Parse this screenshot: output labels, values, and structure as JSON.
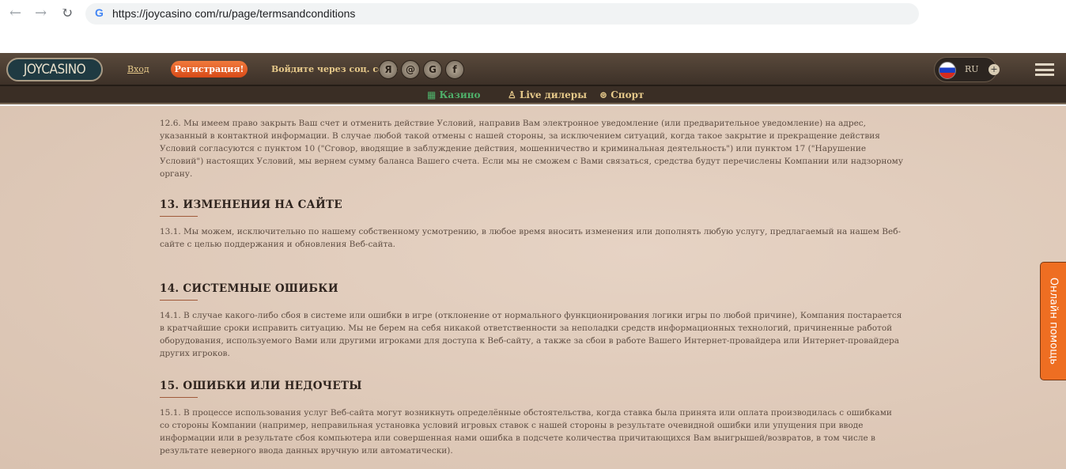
{
  "browser": {
    "url": "https://joycasino com/ru/page/termsandconditions"
  },
  "header": {
    "logo": "JOYCASINO",
    "login": "Вход",
    "register": "Регистрация!",
    "social_label": "Войдите через соц. сети:",
    "social": [
      "Я",
      "@",
      "G",
      "f"
    ],
    "language": "RU"
  },
  "subnav": [
    {
      "icon": "slot-icon",
      "label": "Казино"
    },
    {
      "icon": "dealer-icon",
      "label": "Live дилеры"
    },
    {
      "icon": "ball-icon",
      "label": "Спорт"
    }
  ],
  "content": {
    "p12_6": "12.6. Мы имеем право закрыть Ваш счет и отменить действие Условий, направив Вам электронное уведомление (или предварительное уведомление) на адрес, указанный в контактной информации. В случае любой такой отмены с нашей стороны, за исключением ситуаций, когда такое закрытие и прекращение действия Условий согласуются с пунктом 10 (\"Сговор, вводящие в заблуждение действия, мошенничество и криминальная деятельность\") или пунктом 17 (\"Нарушение Условий\") настоящих Условий, мы вернем сумму баланса Вашего счета. Если мы не сможем с Вами связаться, средства будут перечислены Компании или надзорному органу.",
    "h13": "13. ИЗМЕНЕНИЯ НА САЙТЕ",
    "p13_1": "13.1. Мы можем, исключительно по нашему собственному усмотрению, в любое время вносить изменения или дополнять любую услугу, предлагаемый на нашем Веб-сайте с целью поддержания и обновления Веб-сайта.",
    "h14": "14. СИСТЕМНЫЕ ОШИБКИ",
    "p14_1": "14.1. В случае какого-либо сбоя в системе или ошибки в игре (отклонение от нормального функционирования логики игры по любой причине), Компания постарается в кратчайшие сроки исправить ситуацию. Мы не берем на себя никакой ответственности за неполадки средств информационных технологий, причиненные работой оборудования, используемого Вами или другими игроками для доступа к Веб-сайту, а также за сбои в работе Вашего Интернет-провайдера или Интернет-провайдера других игроков.",
    "h15": "15. ОШИБКИ ИЛИ НЕДОЧЕТЫ",
    "p15_1": "15.1. В процессе использования услуг Веб-сайта могут возникнуть определённые обстоятельства, когда ставка была принята или оплата производилась с ошибками со стороны Компании (например, неправильная установка условий игровых ставок с нашей стороны в результате очевидной ошибки или упущения при вводе информации или в результате сбоя компьютера или совершенная нами ошибка в подсчете количества причитающихся Вам выигрышей/возвратов, в том числе в результате неверного ввода данных вручную или автоматически)."
  },
  "help_tab": "Онлайн помощь"
}
